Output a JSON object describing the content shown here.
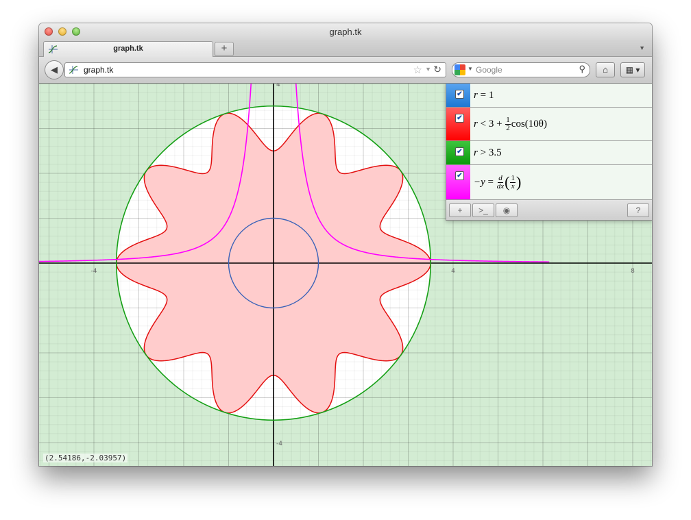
{
  "window": {
    "title": "graph.tk"
  },
  "tab": {
    "label": "graph.tk",
    "new_tab_label": "+"
  },
  "address_bar": {
    "url": "graph.tk"
  },
  "search_bar": {
    "placeholder": "Google"
  },
  "graph": {
    "coordinate_readout": "(2.54186,-2.03957)",
    "tick_labels": {
      "x_neg4": "-4",
      "x_4": "4",
      "x_8": "8",
      "y_4": "4",
      "y_neg4": "-4"
    },
    "colors": {
      "background": "#d3ecd3",
      "region": "#ffcccc",
      "grid": "#aacaaa"
    }
  },
  "equations": [
    {
      "lhs": "r",
      "op": "=",
      "rhs": "1",
      "color": "#1e78d2",
      "checked": true
    },
    {
      "lhs": "r",
      "op": "<",
      "rhs_a": "3 +",
      "frac_num": "1",
      "frac_den": "2",
      "rhs_b": "cos(10θ)",
      "color": "#ff0000",
      "checked": true
    },
    {
      "lhs": "r",
      "op": ">",
      "rhs": "3.5",
      "color": "#0b9a0b",
      "checked": true
    },
    {
      "lhs": "−y",
      "op": "=",
      "frac_num": "d",
      "frac_den": "dx",
      "inner_num": "1",
      "inner_den": "x",
      "color": "#ff00ff",
      "checked": true
    }
  ],
  "panel_buttons": {
    "add": "+",
    "console": ">_",
    "camera": "◉",
    "help": "?"
  }
}
